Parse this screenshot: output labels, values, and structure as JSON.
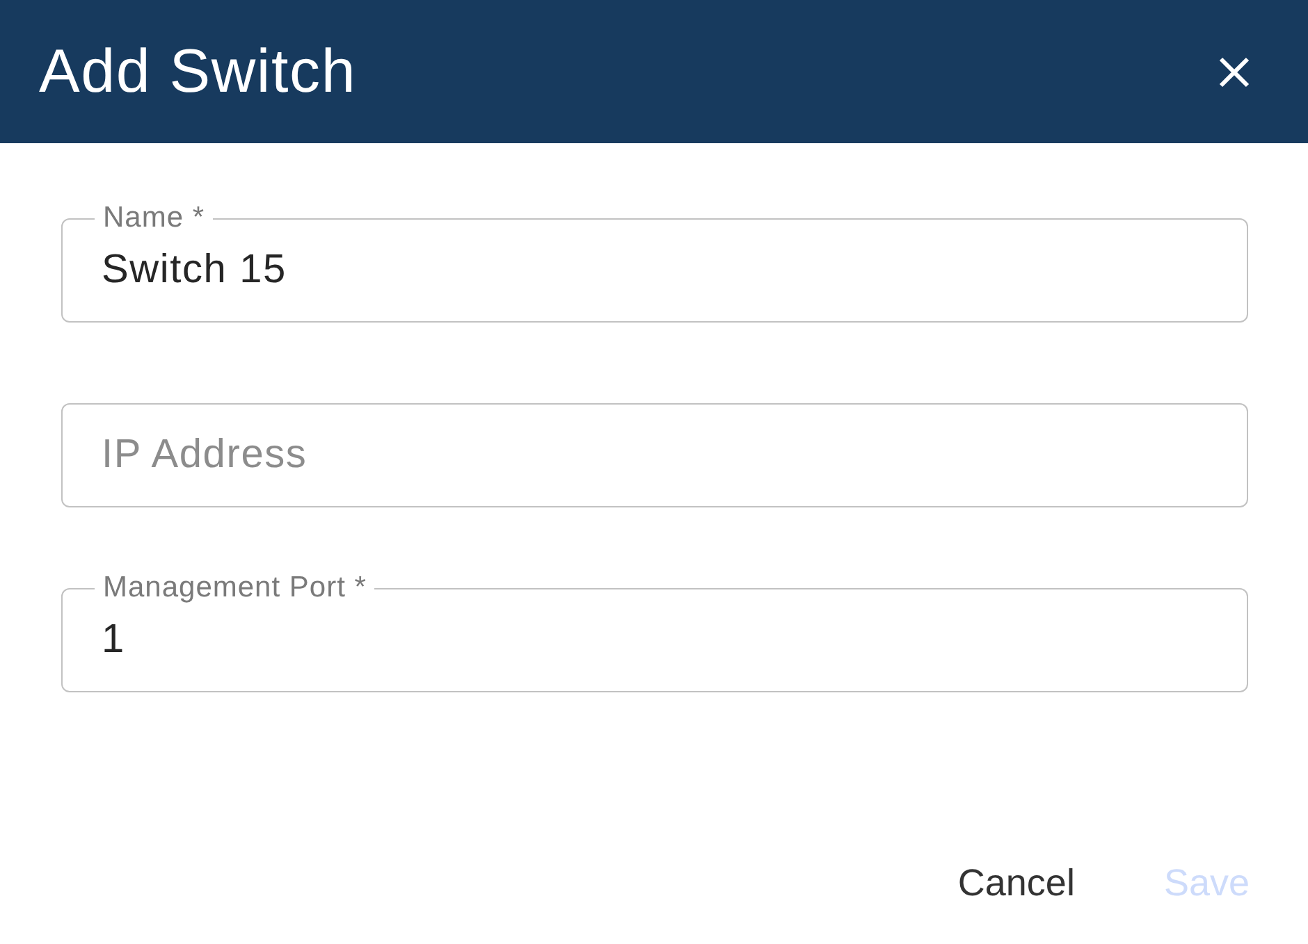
{
  "dialog": {
    "title": "Add Switch"
  },
  "fields": [
    {
      "label": "Name *",
      "value": "Switch 15"
    },
    {
      "placeholder": "IP Address"
    },
    {
      "label": "Management Port *",
      "value": "1"
    }
  ],
  "buttons": [
    {
      "label": "Cancel",
      "disabled": false
    },
    {
      "label": "Save",
      "disabled": true
    }
  ]
}
